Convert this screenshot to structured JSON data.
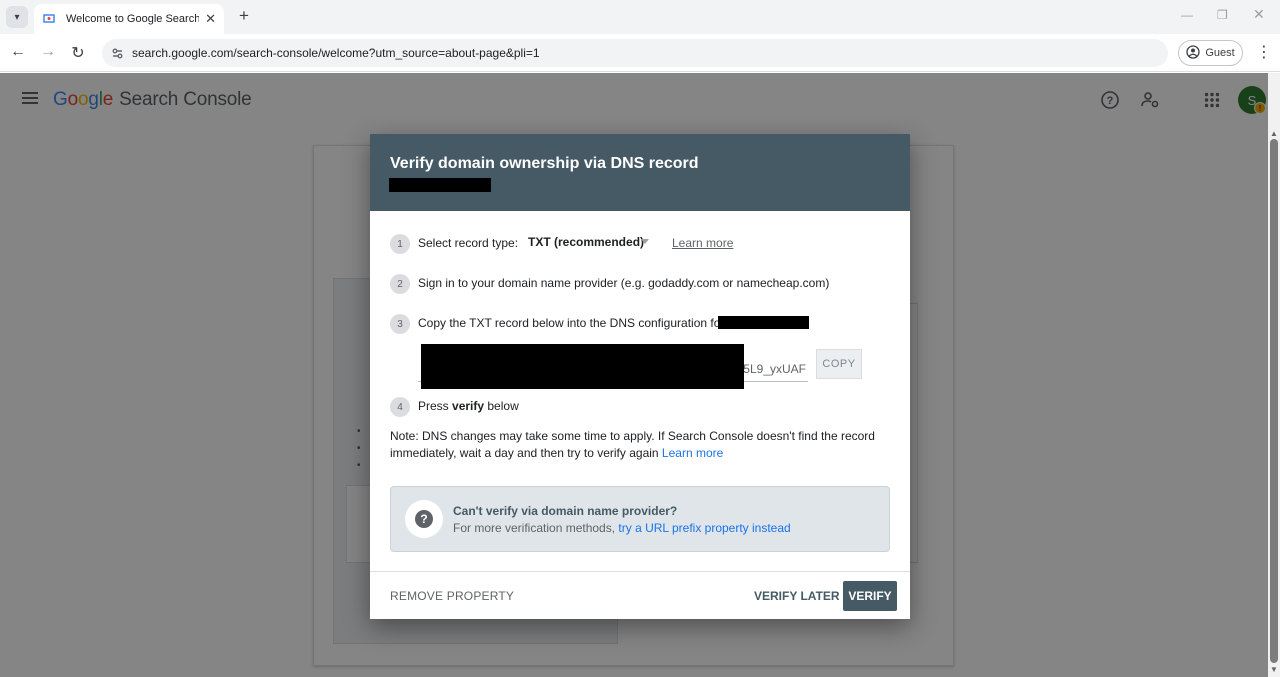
{
  "browser": {
    "tab_title": "Welcome to Google Search Co",
    "url": "search.google.com/search-console/welcome?utm_source=about-page&pli=1",
    "profile_label": "Guest"
  },
  "app": {
    "logo_letters": [
      "G",
      "o",
      "o",
      "g",
      "l",
      "e"
    ],
    "product_name": "Search Console",
    "avatar_initial": "S",
    "badge": "!"
  },
  "background": {
    "bullets": [
      "•",
      "•",
      "•"
    ]
  },
  "dialog": {
    "title": "Verify domain ownership via DNS record",
    "steps": [
      {
        "num": "1",
        "text": "Select record type:"
      },
      {
        "num": "2",
        "text": "Sign in to your domain name provider (e.g. godaddy.com or namecheap.com)"
      },
      {
        "num": "3",
        "text": "Copy the TXT record below into the DNS configuration for"
      },
      {
        "num": "4",
        "text_before": "Press ",
        "text_bold": "verify",
        "text_after": " below"
      }
    ],
    "record_type_value": "TXT (recommended)",
    "learn_more_1": "Learn more",
    "txt_record_visible_tail": "-5L9_yxUAF",
    "copy_label": "COPY",
    "note_text": "Note: DNS changes may take some time to apply. If Search Console doesn't find the record immediately, wait a day and then try to verify again",
    "note_link": "Learn more",
    "alt": {
      "icon": "?",
      "title": "Can't verify via domain name provider?",
      "desc_prefix": "For more verification methods,",
      "desc_link": "try a URL prefix property instead"
    },
    "footer": {
      "remove": "REMOVE PROPERTY",
      "verify_later": "VERIFY LATER",
      "verify": "VERIFY"
    }
  },
  "colors": {
    "header": "#455a64",
    "link": "#1a73e8"
  }
}
